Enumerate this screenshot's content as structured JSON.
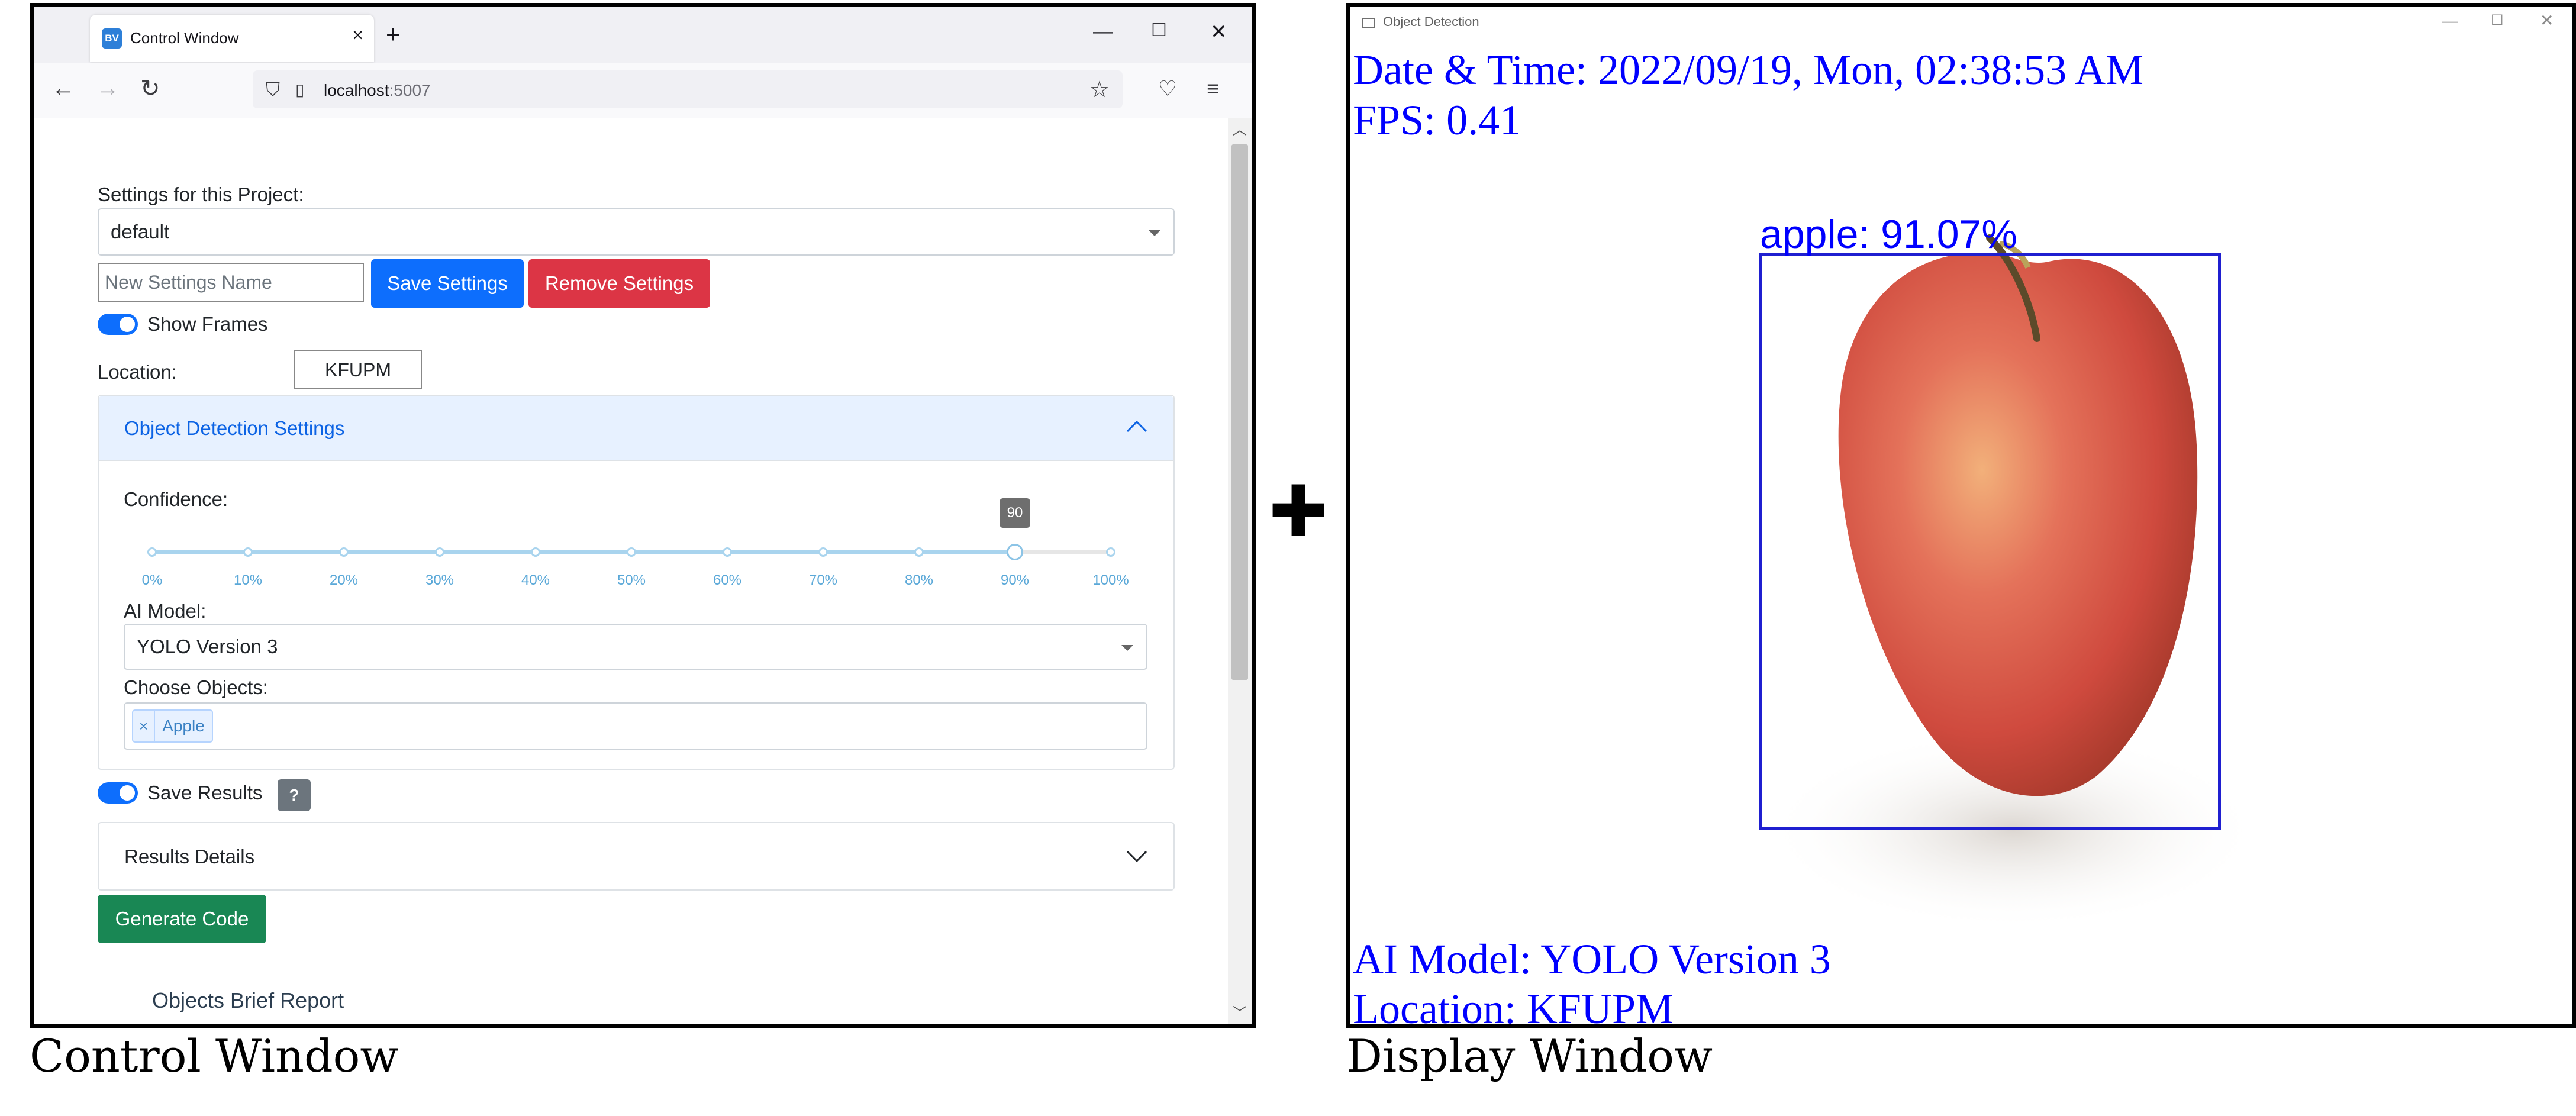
{
  "control_window": {
    "tab_title": "Control Window",
    "favicon_text": "BV",
    "url_host": "localhost",
    "url_port": ":5007",
    "settings_label": "Settings for this Project:",
    "settings_selected": "default",
    "new_settings_placeholder": "New Settings Name",
    "save_settings_label": "Save Settings",
    "remove_settings_label": "Remove Settings",
    "show_frames_label": "Show Frames",
    "location_label": "Location:",
    "location_value": "KFUPM",
    "object_detection_header": "Object Detection Settings",
    "confidence_label": "Confidence:",
    "confidence_value": 90,
    "confidence_tooltip": "90",
    "confidence_ticks": [
      "0%",
      "10%",
      "20%",
      "30%",
      "40%",
      "50%",
      "60%",
      "70%",
      "80%",
      "90%",
      "100%"
    ],
    "ai_model_label": "AI Model:",
    "ai_model_selected": "YOLO Version 3",
    "choose_objects_label": "Choose Objects:",
    "selected_object": "Apple",
    "tag_remove": "×",
    "save_results_label": "Save Results",
    "help_icon_text": "?",
    "results_details_header": "Results Details",
    "generate_code_label": "Generate Code",
    "brief_report_label": "Objects Brief Report",
    "colors": {
      "primary": "#0d6efd",
      "danger": "#dc3545",
      "success": "#198754",
      "accordion_active": "#e7f1ff"
    }
  },
  "display_window": {
    "title": "Object Detection",
    "datetime_text": "Date & Time: 2022/09/19, Mon, 02:38:53 AM",
    "fps_text": "FPS: 0.41",
    "detection_label": "apple: 91.07%",
    "ai_model_text": "AI Model: YOLO Version 3",
    "location_text": "Location: KFUPM",
    "overlay_color": "#0000ff"
  },
  "plus_sign": "✚",
  "captions": {
    "left": "Control Window",
    "right": "Display Window"
  }
}
